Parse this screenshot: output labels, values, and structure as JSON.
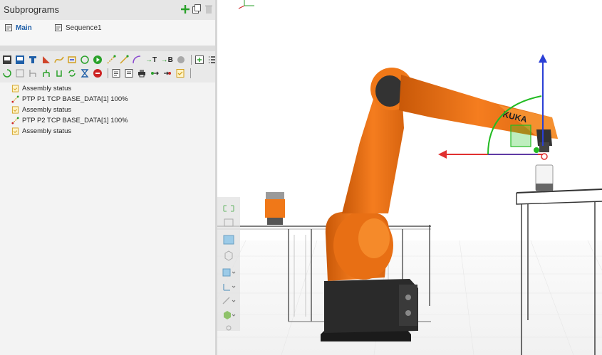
{
  "subprograms": {
    "title": "Subprograms",
    "tabs": [
      {
        "label": "Main",
        "active": true
      },
      {
        "label": "Sequence1",
        "active": false
      }
    ]
  },
  "toolbar": {
    "text_buttons": [
      "T",
      "B",
      "T",
      "B"
    ]
  },
  "program": {
    "lines": [
      {
        "text": "Assembly status",
        "icon": "assembly-status-icon"
      },
      {
        "text": "PTP P1 TCP BASE_DATA[1] 100%",
        "icon": "ptp-motion-icon"
      },
      {
        "text": "Assembly status",
        "icon": "assembly-status-icon"
      },
      {
        "text": "PTP P2 TCP BASE_DATA[1] 100%",
        "icon": "ptp-motion-icon"
      },
      {
        "text": "Assembly status",
        "icon": "assembly-status-icon"
      }
    ]
  },
  "viewport": {
    "robot_brand": "KUKA",
    "robot_color": "#f07818",
    "axis_colors": {
      "x": "#e03030",
      "y": "#22bb22",
      "z": "#2a3fd6"
    }
  }
}
